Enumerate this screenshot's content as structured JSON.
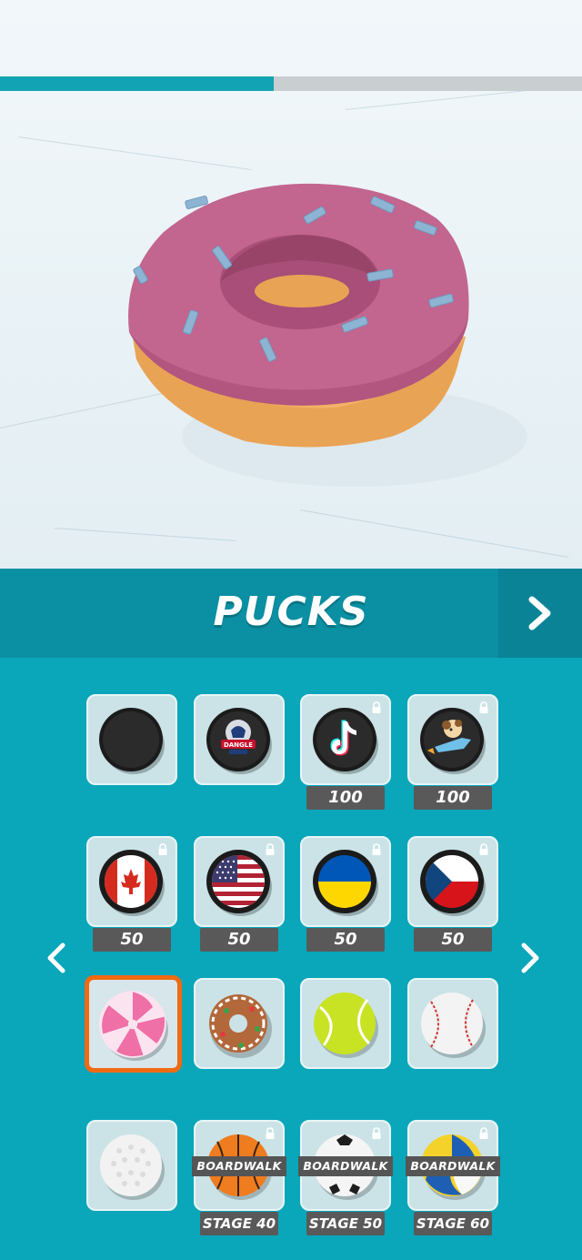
{
  "progress": {
    "fraction": 0.47
  },
  "colors": {
    "accent": "#0aa6ba",
    "header": "#0b8fa2",
    "selected_border": "#f06a12",
    "price_bg": "#595959"
  },
  "preview": {
    "item_name": "donut-puck"
  },
  "header": {
    "title": "PUCKS",
    "next_icon": "chevron-right-icon"
  },
  "nav": {
    "prev_icon": "chevron-left-icon",
    "next_icon": "chevron-right-icon"
  },
  "grid": {
    "rows": [
      [
        {
          "name": "black-puck",
          "locked": false,
          "price": null
        },
        {
          "name": "dangle-puck",
          "locked": false,
          "price": null,
          "logo_text": "DANGLE"
        },
        {
          "name": "tiktok-puck",
          "locked": true,
          "price": "100"
        },
        {
          "name": "rocket-dog-puck",
          "locked": true,
          "price": "100"
        }
      ],
      [
        {
          "name": "canada-puck",
          "locked": true,
          "price": "50"
        },
        {
          "name": "usa-puck",
          "locked": true,
          "price": "50"
        },
        {
          "name": "ukraine-puck",
          "locked": true,
          "price": "50"
        },
        {
          "name": "czech-puck",
          "locked": true,
          "price": "50"
        }
      ],
      [
        {
          "name": "peppermint-candy-puck",
          "locked": false,
          "price": null,
          "selected": true
        },
        {
          "name": "gingerbread-donut-puck",
          "locked": false,
          "price": null
        },
        {
          "name": "tennis-ball-puck",
          "locked": false,
          "price": null
        },
        {
          "name": "baseball-puck",
          "locked": false,
          "price": null
        }
      ],
      [
        {
          "name": "golf-ball-puck",
          "locked": false,
          "price": null
        },
        {
          "name": "basketball-puck",
          "locked": true,
          "banner": "BOARDWALK",
          "stage": "STAGE 40"
        },
        {
          "name": "soccer-ball-puck",
          "locked": true,
          "banner": "BOARDWALK",
          "stage": "STAGE 50"
        },
        {
          "name": "volleyball-puck",
          "locked": true,
          "banner": "BOARDWALK",
          "stage": "STAGE 60"
        }
      ]
    ]
  }
}
